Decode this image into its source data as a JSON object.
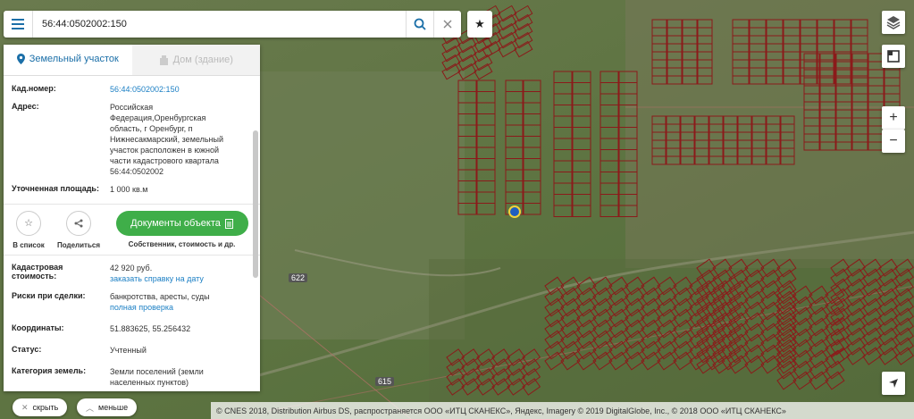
{
  "search": {
    "value": "56:44:0502002:150"
  },
  "panel": {
    "tabs": [
      {
        "label": "Земельный участок"
      },
      {
        "label": "Дом (здание)"
      }
    ],
    "fields": [
      {
        "label": "Кад.номер:",
        "value": "56:44:0502002:150"
      },
      {
        "label": "Адрес:",
        "value": "Российская Федерация,Оренбургская область, г Оренбург, п Нижнесакмарский, земельный участок расположен в южной части кадастрового квартала 56:44:0502002"
      },
      {
        "label": "Уточненная площадь:",
        "value": "1 000 кв.м"
      }
    ],
    "actions": {
      "save_label": "В список",
      "share_label": "Поделиться",
      "docs_label": "Документы объекта",
      "docs_sub": "Собственник, стоимость и др."
    },
    "fields2": [
      {
        "label": "Кадастровая стоимость:",
        "value": "42 920 руб.",
        "link": "заказать справку на дату"
      },
      {
        "label": "Риски при сделки:",
        "value": "банкротства, аресты, суды",
        "link": "полная проверка"
      },
      {
        "label": "Координаты:",
        "value": "51.883625, 55.256432"
      },
      {
        "label": "Статус:",
        "value": "Учтенный"
      },
      {
        "label": "Категория земель:",
        "value": "Земли поселений (земли населенных пунктов)"
      }
    ]
  },
  "bottom": {
    "hide_label": "скрыть",
    "less_label": "меньше"
  },
  "map": {
    "attribution": "© CNES 2018, Distribution Airbus DS, распространяется ООО «ИТЦ СКАНЕКС», Яндекс, Imagery © 2019 DigitalGlobe, Inc., © 2018 ООО «ИТЦ СКАНЕКС»",
    "road_badges": [
      "622",
      "615"
    ],
    "zoom_in": "+",
    "zoom_out": "−",
    "selected_marker_color": "#1f5fbf"
  }
}
